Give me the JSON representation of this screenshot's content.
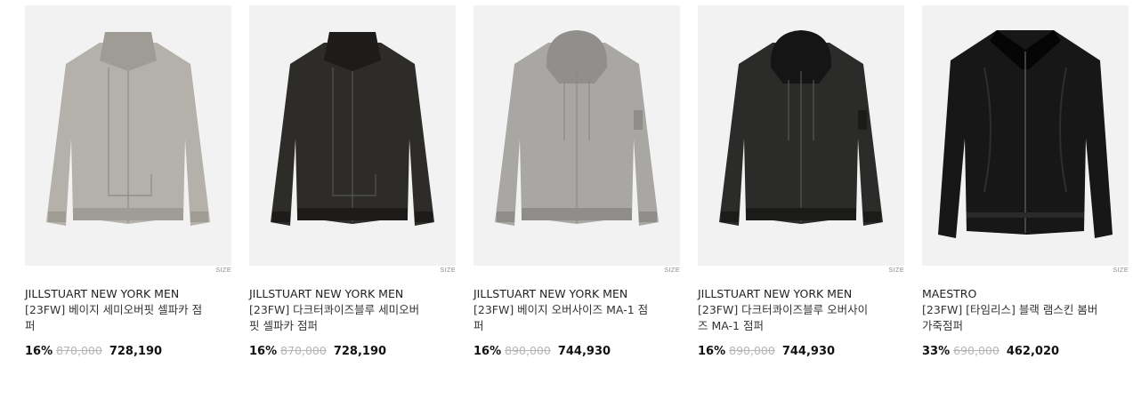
{
  "products": [
    {
      "size_label": "SIZE",
      "brand": "JILLSTUART NEW YORK MEN",
      "name": "[23FW] 베이지 세미오버핏 셀파카 점퍼",
      "discount_rate": "16%",
      "original_price": "870,000",
      "sale_price": "728,190",
      "image": {
        "icon": "jacket-image",
        "style": "funnel",
        "body_color": "#b4b0aa",
        "shade_color": "#9f9b95",
        "hood_color": ""
      }
    },
    {
      "size_label": "SIZE",
      "brand": "JILLSTUART NEW YORK MEN",
      "name": "[23FW] 다크터콰이즈블루 세미오버핏 셀파카 점퍼",
      "discount_rate": "16%",
      "original_price": "870,000",
      "sale_price": "728,190",
      "image": {
        "icon": "jacket-image",
        "style": "funnel",
        "body_color": "#2e2c29",
        "shade_color": "#1e1c1a",
        "hood_color": ""
      }
    },
    {
      "size_label": "SIZE",
      "brand": "JILLSTUART NEW YORK MEN",
      "name": "[23FW] 베이지 오버사이즈 MA-1 점퍼",
      "discount_rate": "16%",
      "original_price": "890,000",
      "sale_price": "744,930",
      "image": {
        "icon": "jacket-image",
        "style": "hood",
        "body_color": "#a9a7a4",
        "shade_color": "#8f8d89",
        "hood_color": "#918f8b"
      }
    },
    {
      "size_label": "SIZE",
      "brand": "JILLSTUART NEW YORK MEN",
      "name": "[23FW] 다크터콰이즈블루 오버사이즈 MA-1 점퍼",
      "discount_rate": "16%",
      "original_price": "890,000",
      "sale_price": "744,930",
      "image": {
        "icon": "jacket-image",
        "style": "hood",
        "body_color": "#2b2b2a",
        "shade_color": "#1b1b1a",
        "hood_color": "#151515"
      }
    },
    {
      "size_label": "SIZE",
      "brand": "MAESTRO",
      "name": "[23FW] [타임리스] 블랙 램스킨 봄버 가죽점퍼",
      "discount_rate": "33%",
      "original_price": "690,000",
      "sale_price": "462,020",
      "image": {
        "icon": "jacket-image",
        "style": "collar",
        "body_color": "#171717",
        "shade_color": "#050505",
        "hood_color": ""
      }
    }
  ]
}
